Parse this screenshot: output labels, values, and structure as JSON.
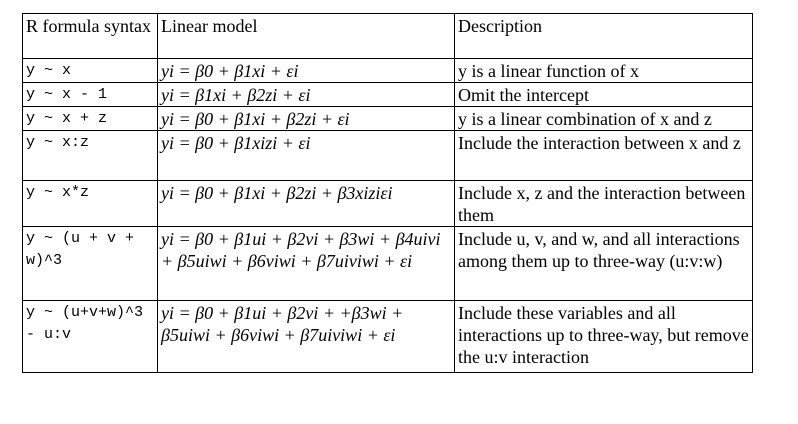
{
  "headers": [
    "R formula syntax",
    "Linear model",
    "Description"
  ],
  "rows": [
    {
      "formula": "y ~ x",
      "model": "yi = β0 + β1xi + εi",
      "description": "y is a linear function of x"
    },
    {
      "formula": "y ~ x - 1",
      "model": "yi = β1xi + β2zi + εi",
      "description": "Omit the intercept"
    },
    {
      "formula": "y ~ x + z",
      "model": "yi = β0 + β1xi + β2zi + εi",
      "description": "y is a linear combination of x and z"
    },
    {
      "formula": "y ~ x:z",
      "model": "yi = β0 + β1xizi + εi",
      "description": "Include the interaction between x and z"
    },
    {
      "formula": "y ~ x*z",
      "model": "yi = β0 + β1xi + β2zi + β3xiziεi",
      "description": "Include x, z and the interaction between them"
    },
    {
      "formula": "y ~ (u + v + w)^3",
      "model": "yi = β0 + β1ui + β2vi + β3wi + β4uivi + β5uiwi + β6viwi + β7uiviwi + εi",
      "description": "Include u, v, and w, and all interactions among them up to three-way (u:v:w)"
    },
    {
      "formula": "y ~ (u+v+w)^3 - u:v",
      "model": "yi = β0 + β1ui + β2vi + +β3wi + β5uiwi + β6viwi + β7uiviwi + εi",
      "description": "Include these variables and all interactions up to three-way, but remove the u:v interaction"
    }
  ]
}
